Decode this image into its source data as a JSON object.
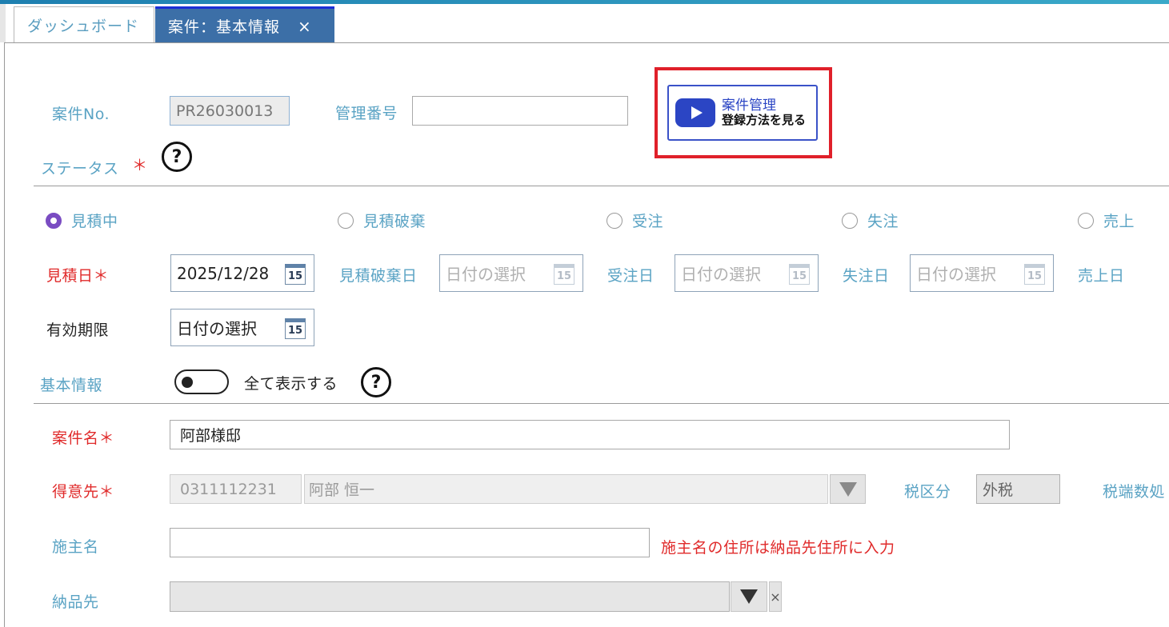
{
  "tabs": {
    "dashboard": "ダッシュボード",
    "active": "案件：基本情報",
    "close": "×"
  },
  "header": {
    "case_no_label": "案件No.",
    "case_no_value": "PR26030013",
    "mgmt_no_label": "管理番号",
    "mgmt_no_value": "",
    "video_line1": "案件管理",
    "video_line2": "登録方法を見る"
  },
  "status": {
    "label": "ステータス",
    "required_mark": "＊",
    "help": "?",
    "options": [
      "見積中",
      "見積破棄",
      "受注",
      "失注",
      "売上"
    ],
    "selected": "見積中"
  },
  "dates": {
    "estimate_label": "見積日＊",
    "estimate_value": "2025/12/28",
    "discard_label": "見積破棄日",
    "order_label": "受注日",
    "lost_label": "失注日",
    "sales_label": "売上日",
    "validity_label": "有効期限",
    "placeholder": "日付の選択",
    "cal_day": "15"
  },
  "basic": {
    "label": "基本情報",
    "show_all": "全て表示する",
    "help": "?"
  },
  "fields": {
    "case_name_label": "案件名＊",
    "case_name_value": "阿部様邸",
    "customer_label": "得意先＊",
    "customer_code": "0311112231",
    "customer_name": "阿部 恒一",
    "tax_label": "税区分",
    "tax_value": "外税",
    "tax_round_label": "税端数処",
    "owner_label": "施主名",
    "owner_value": "",
    "owner_note": "施主名の住所は納品先住所に入力",
    "delivery_label": "納品先",
    "delivery_value": "",
    "clear": "×"
  }
}
